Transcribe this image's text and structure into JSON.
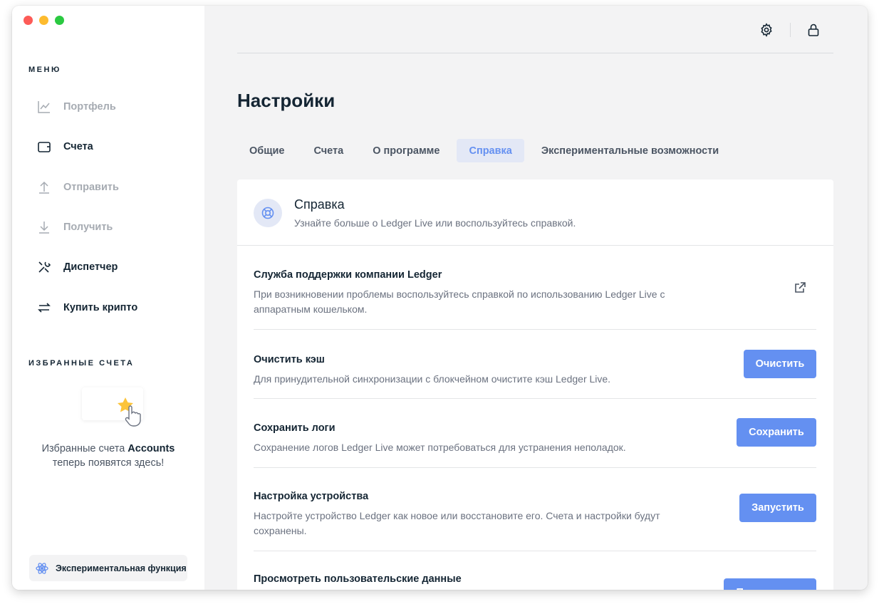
{
  "sidebar": {
    "menu_title": "МЕНЮ",
    "items": [
      {
        "label": "Портфель",
        "icon": "chart-line-icon",
        "enabled": false
      },
      {
        "label": "Счета",
        "icon": "wallet-icon",
        "enabled": true
      },
      {
        "label": "Отправить",
        "icon": "arrow-up-icon",
        "enabled": false
      },
      {
        "label": "Получить",
        "icon": "arrow-down-icon",
        "enabled": false
      },
      {
        "label": "Диспетчер",
        "icon": "tools-icon",
        "enabled": true
      },
      {
        "label": "Купить крипто",
        "icon": "exchange-icon",
        "enabled": true
      }
    ],
    "favorites_title": "ИЗБРАННЫЕ СЧЕТА",
    "favorites_text_1": "Избранные счета ",
    "favorites_text_bold": "Accounts",
    "favorites_text_2": "теперь появятся здесь!",
    "experimental_label": "Экспериментальная функция"
  },
  "header": {
    "settings_icon": "gear-icon",
    "lock_icon": "lock-icon"
  },
  "page": {
    "title": "Настройки",
    "tabs": [
      {
        "label": "Общие",
        "active": false
      },
      {
        "label": "Счета",
        "active": false
      },
      {
        "label": "О программе",
        "active": false
      },
      {
        "label": "Справка",
        "active": true
      },
      {
        "label": "Экспериментальные возможности",
        "active": false
      }
    ]
  },
  "help": {
    "title": "Справка",
    "description": "Узнайте больше о Ledger Live или воспользуйтесь справкой.",
    "rows": [
      {
        "title": "Служба поддержки компании Ledger",
        "description": "При возникновении проблемы воспользуйтесь справкой по использованию Ledger Live с аппаратным кошельком.",
        "action": "external-link-icon"
      },
      {
        "title": "Очистить кэш",
        "description": "Для принудительной синхронизации с блокчейном очистите кэш Ledger Live.",
        "button": "Очистить"
      },
      {
        "title": "Сохранить логи",
        "description": "Сохранение логов Ledger Live может потребоваться для устранения неполадок.",
        "button": "Сохранить"
      },
      {
        "title": "Настройка устройства",
        "description": "Настройте устройство Ledger как новое или восстановите его. Счета и настройки будут сохранены.",
        "button": "Запустить"
      },
      {
        "title": "Просмотреть пользовательские данные",
        "description": "",
        "button": "Просмотреть"
      }
    ]
  },
  "colors": {
    "accent": "#6490f1",
    "text": "#142533",
    "muted": "#6b7280"
  }
}
